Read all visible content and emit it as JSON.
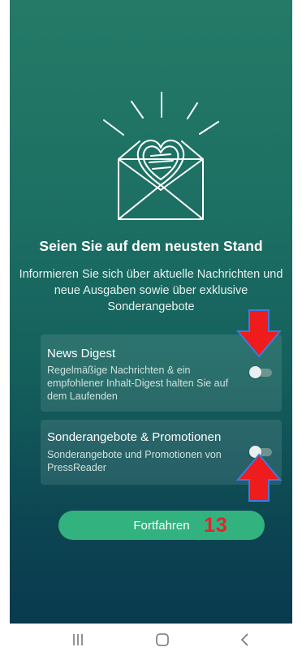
{
  "screen": {
    "title": "Seien Sie auf dem neusten Stand",
    "subtitle": "Informieren Sie sich über aktuelle Nachrichten und neue Ausgaben sowie über exklusive Sonderangebote"
  },
  "cards": [
    {
      "title": "News Digest",
      "description": "Regelmäßige Nachrichten & ein empfohlener Inhalt-Digest halten Sie auf dem Laufenden",
      "toggle_on": false
    },
    {
      "title": "Sonderangebote & Promotionen",
      "description": "Sonderangebote und Promotionen von PressReader",
      "toggle_on": false
    }
  ],
  "button": {
    "label": "Fortfahren"
  },
  "annotation": {
    "step_number": "13",
    "color": "#e0262a"
  },
  "colors": {
    "accent": "#32b27f",
    "background_top": "#247a66",
    "background_bottom": "#093a4e"
  },
  "icons": {
    "hero": "envelope-heart-icon",
    "nav": [
      "recent-apps-icon",
      "home-icon",
      "back-icon"
    ]
  }
}
